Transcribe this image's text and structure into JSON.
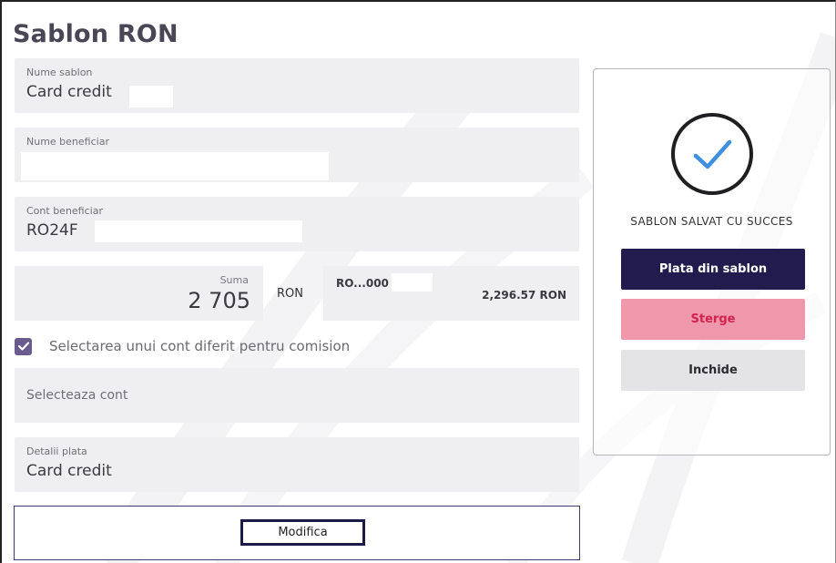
{
  "page": {
    "title": "Sablon RON"
  },
  "form": {
    "template_name": {
      "label": "Nume sablon",
      "value": "Card credit"
    },
    "beneficiary_name": {
      "label": "Nume beneficiar",
      "value": ""
    },
    "beneficiary_account": {
      "label": "Cont beneficiar",
      "value": "RO24F"
    },
    "amount": {
      "label": "Suma",
      "value": "2 705",
      "currency": "RON"
    },
    "source_account": {
      "account": "RO...000",
      "balance": "2,296.57 RON"
    },
    "commission_checkbox": {
      "label": "Selectarea unui cont diferit pentru comision",
      "checked": true
    },
    "commission_account": {
      "placeholder": "Selecteaza cont"
    },
    "payment_details": {
      "label": "Detalii plata",
      "value": "Card credit"
    },
    "submit_label": "Modifica"
  },
  "dialog": {
    "message": "SABLON SALVAT CU SUCCES",
    "icon": "check-circle-icon",
    "buttons": {
      "pay": "Plata din sablon",
      "delete": "Sterge",
      "close": "Inchide"
    }
  },
  "colors": {
    "primary": "#221c4e",
    "danger_bg": "#ef97ab",
    "danger_text": "#d3234f",
    "accent_check": "#3f8fe0",
    "checkbox": "#6b5a8e",
    "field_bg": "#efeff1"
  }
}
